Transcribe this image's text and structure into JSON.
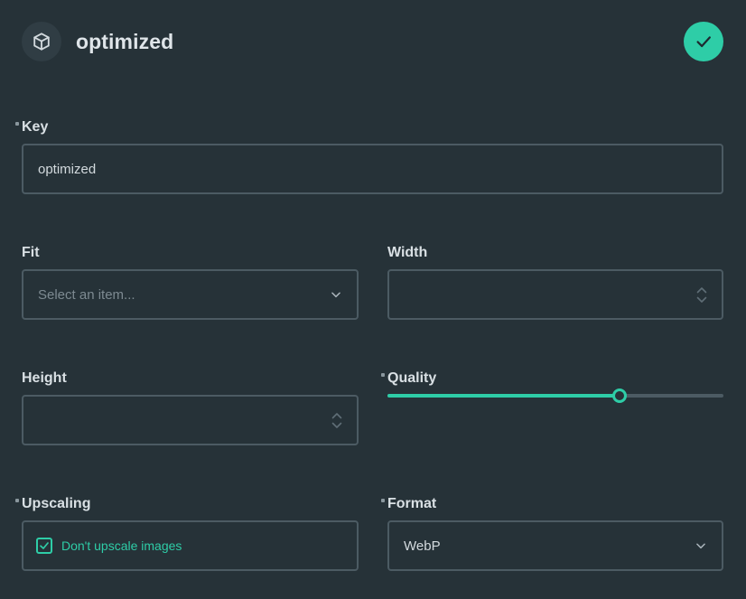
{
  "header": {
    "icon": "box-icon",
    "title": "optimized",
    "save_icon": "check-icon"
  },
  "fields": {
    "key": {
      "label": "Key",
      "value": "optimized",
      "required": true
    },
    "fit": {
      "label": "Fit",
      "placeholder": "Select an item...",
      "required": false
    },
    "width": {
      "label": "Width",
      "value": "",
      "required": false
    },
    "height": {
      "label": "Height",
      "value": "",
      "required": false
    },
    "quality": {
      "label": "Quality",
      "value_fraction": 0.69,
      "required": true
    },
    "upscaling": {
      "label": "Upscaling",
      "checkbox_label": "Don't upscale images",
      "checked": true,
      "required": true
    },
    "format": {
      "label": "Format",
      "value": "WebP",
      "required": true
    }
  },
  "colors": {
    "background": "#263238",
    "accent": "#2ecda7",
    "border": "#4c5b63"
  }
}
